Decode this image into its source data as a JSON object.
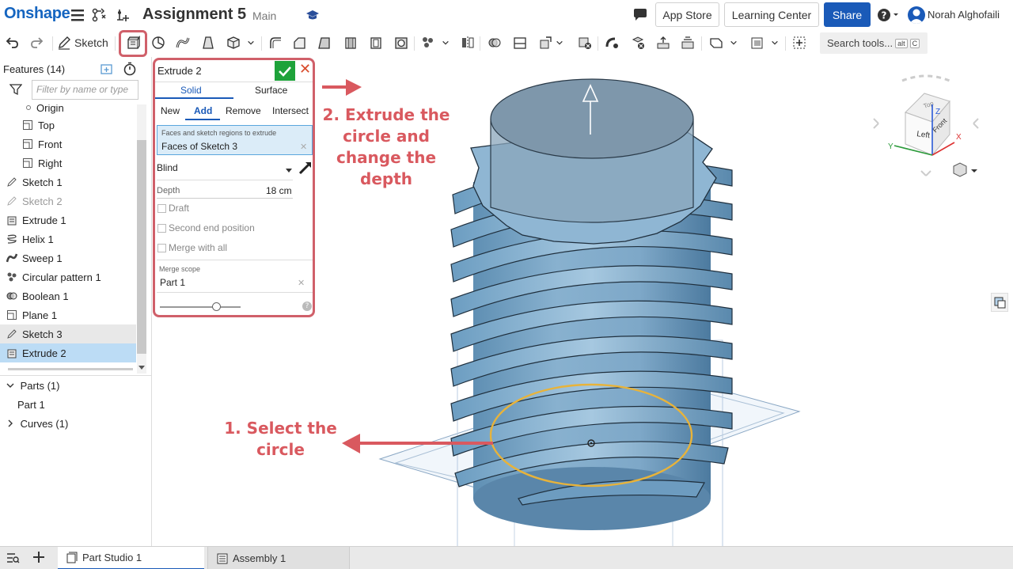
{
  "app": {
    "logo": "Onshape",
    "document_title": "Assignment 5",
    "branch": "Main"
  },
  "topbar": {
    "app_store": "App Store",
    "learning_center": "Learning Center",
    "share": "Share",
    "user_name": "Norah Alghofaili"
  },
  "toolbar": {
    "sketch_label": "Sketch",
    "search_placeholder": "Search tools...",
    "search_kbd_1": "alt",
    "search_kbd_2": "C"
  },
  "features": {
    "header": "Features (14)",
    "filter_placeholder": "Filter by name or type",
    "items": [
      {
        "label": "Origin"
      },
      {
        "label": "Top"
      },
      {
        "label": "Front"
      },
      {
        "label": "Right"
      },
      {
        "label": "Sketch 1"
      },
      {
        "label": "Sketch 2"
      },
      {
        "label": "Extrude 1"
      },
      {
        "label": "Helix 1"
      },
      {
        "label": "Sweep 1"
      },
      {
        "label": "Circular pattern 1"
      },
      {
        "label": "Boolean 1"
      },
      {
        "label": "Plane 1"
      },
      {
        "label": "Sketch 3"
      },
      {
        "label": "Extrude 2"
      }
    ],
    "parts": "Parts (1)",
    "part_1": "Part 1",
    "curves": "Curves (1)"
  },
  "dialog": {
    "title": "Extrude 2",
    "tab_solid": "Solid",
    "tab_surface": "Surface",
    "op_new": "New",
    "op_add": "Add",
    "op_remove": "Remove",
    "op_intersect": "Intersect",
    "faces_label": "Faces and sketch regions to extrude",
    "faces_value": "Faces of Sketch 3",
    "end_type": "Blind",
    "depth_label": "Depth",
    "depth_value": "18 cm",
    "draft": "Draft",
    "second_end": "Second end position",
    "merge_all": "Merge with all",
    "merge_scope_label": "Merge scope",
    "merge_scope_value": "Part 1",
    "slider_level": 0.7
  },
  "annotations": {
    "step2": "2. Extrude the circle and change the depth",
    "step2_lines": [
      "2. Extrude the",
      "circle and",
      "change the",
      "depth"
    ],
    "step1_lines": [
      "1. Select the",
      "circle"
    ]
  },
  "viewcube": {
    "face_left": "Left",
    "face_front": "Front",
    "face_top": "Top",
    "axis_x": "X",
    "axis_y": "Y",
    "axis_z": "Z"
  },
  "bottom_tabs": [
    {
      "label": "Part Studio 1"
    },
    {
      "label": "Assembly 1"
    }
  ],
  "colors": {
    "accent": "#1a5ab8",
    "annotation": "#d9595f",
    "selection": "#bcdcf5",
    "model": "#8fb6d3",
    "highlight_circle": "#e8b33a",
    "ok_green": "#1ea23a"
  }
}
